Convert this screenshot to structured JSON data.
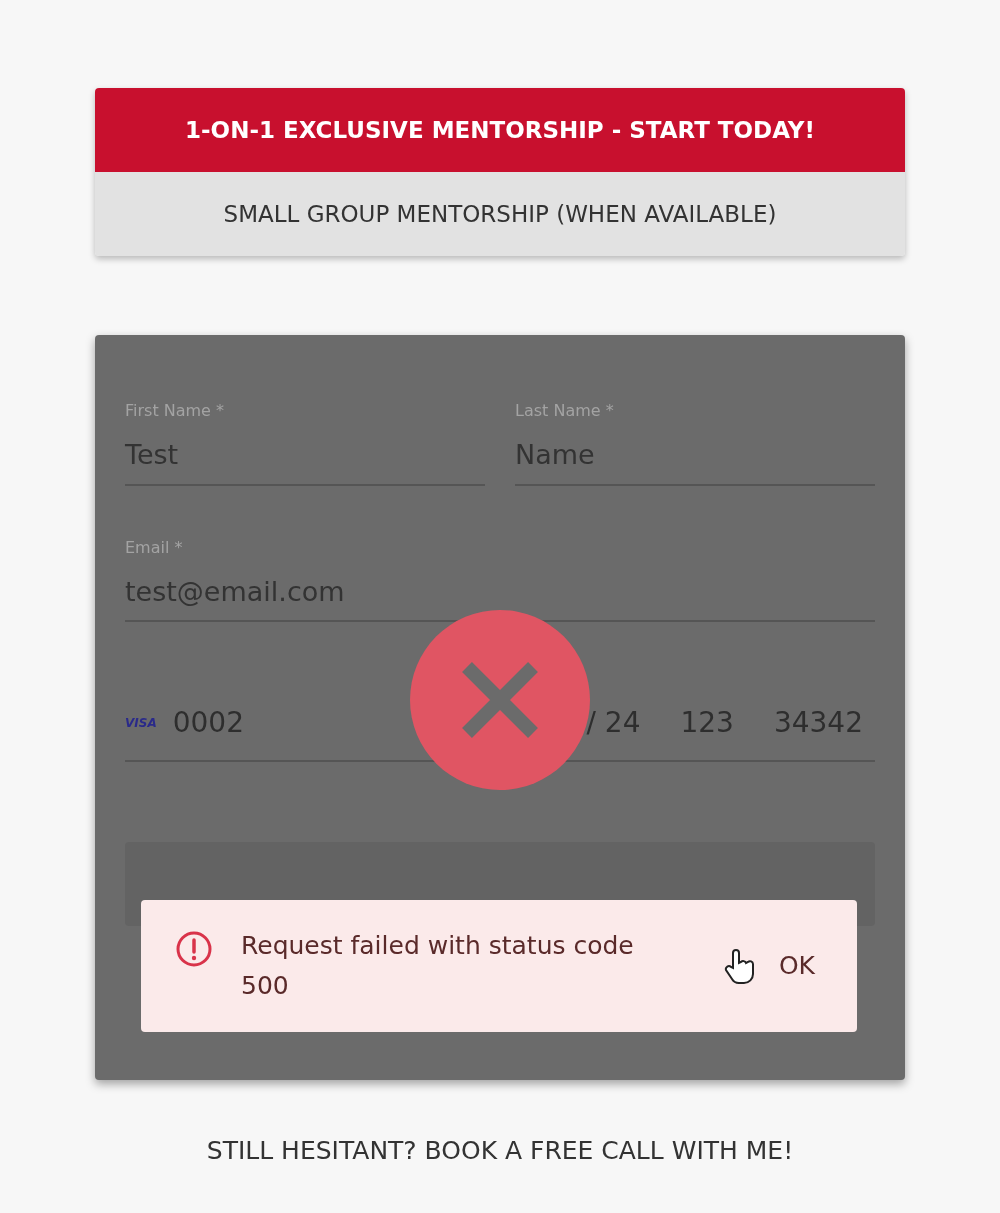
{
  "plans": [
    {
      "label": "1-ON-1 EXCLUSIVE MENTORSHIP - START TODAY!",
      "selected": true
    },
    {
      "label": "SMALL GROUP MENTORSHIP (WHEN AVAILABLE)",
      "selected": false
    }
  ],
  "form": {
    "fields": [
      {
        "label": "First Name *",
        "value": "Test"
      },
      {
        "label": "Last Name *",
        "value": "Name"
      },
      {
        "label": "Email *",
        "value": "test@email.com"
      }
    ],
    "card": {
      "brand": "VISA",
      "number": "0002",
      "expiry": "/ 24",
      "cvc": "123",
      "zip": "34342"
    },
    "failed": true
  },
  "toast": {
    "message": "Request failed with status code 500",
    "button": "OK"
  },
  "footer_link": "STILL HESITANT? BOOK A FREE CALL WITH ME!"
}
